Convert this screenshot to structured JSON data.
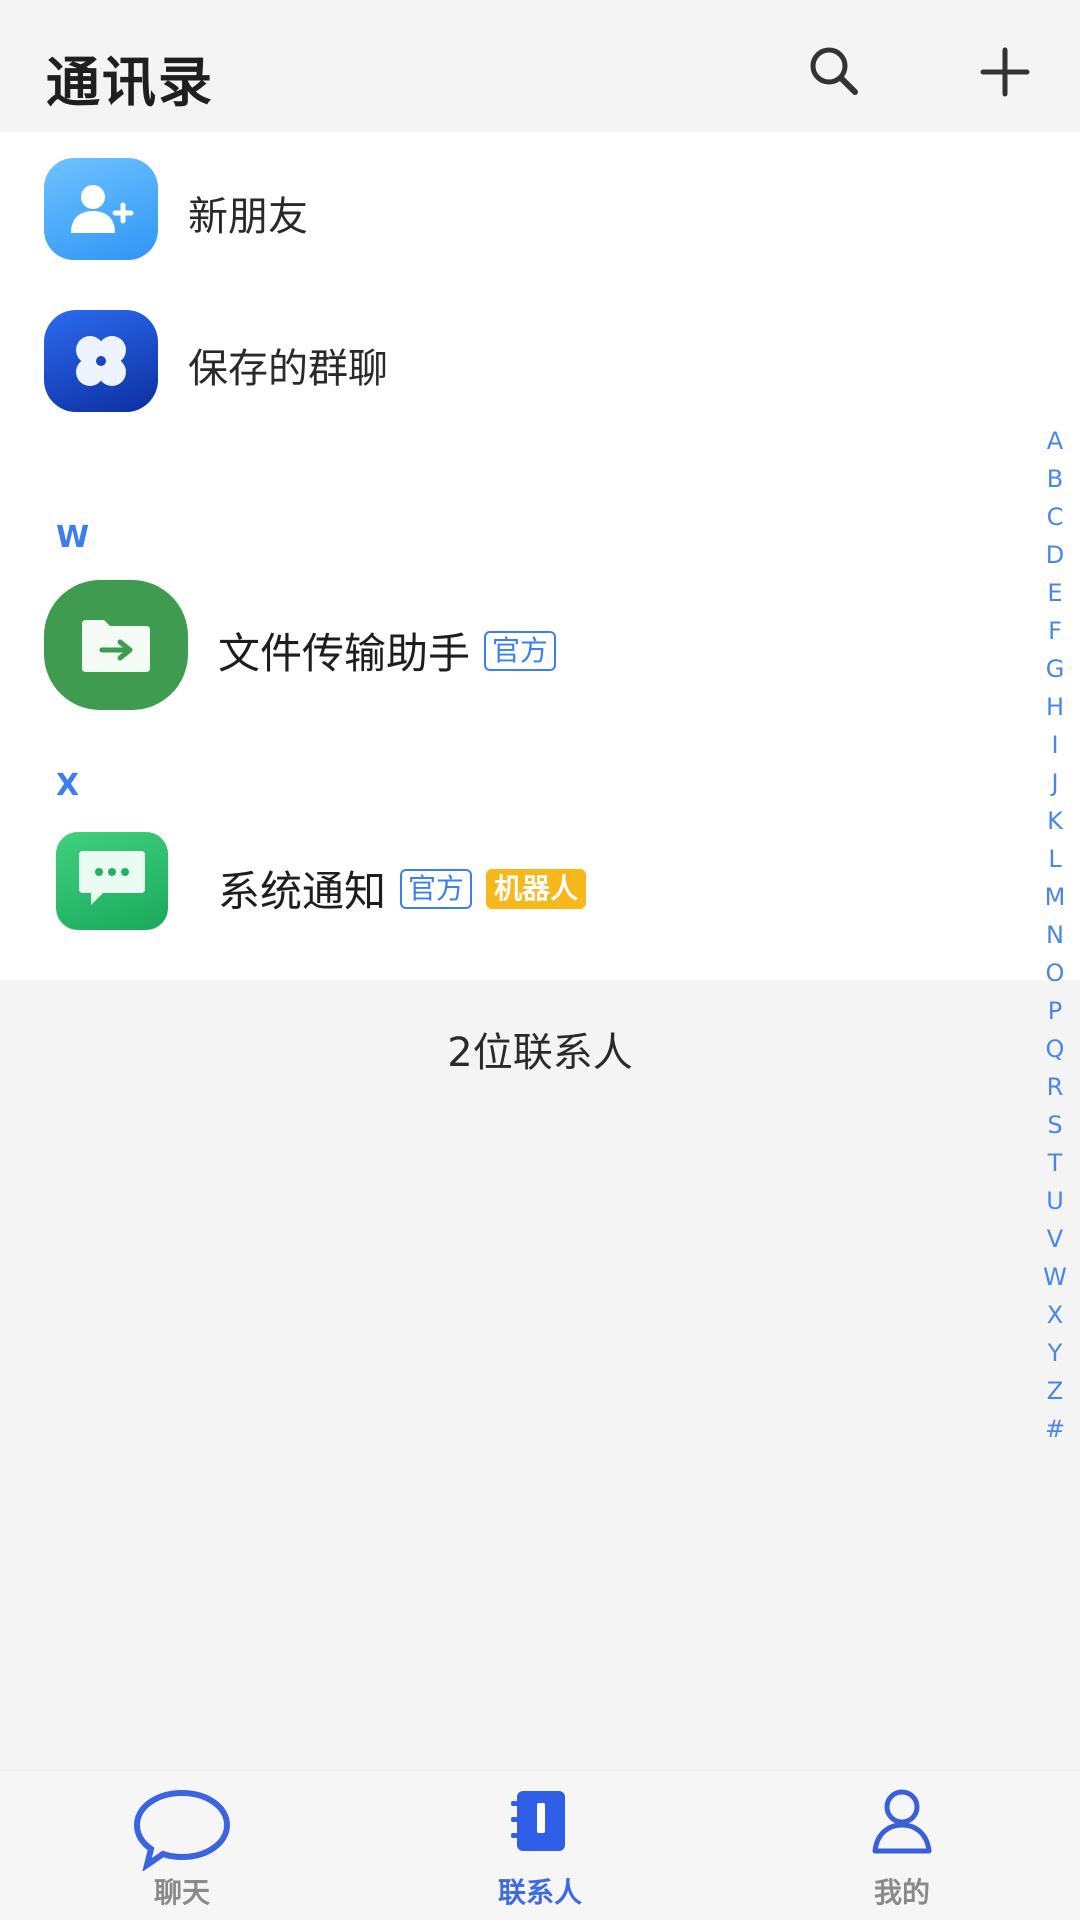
{
  "header": {
    "title": "通讯录"
  },
  "icons": {
    "search": "search-icon",
    "add": "plus-icon"
  },
  "list": {
    "new_friends": "新朋友",
    "saved_groups": "保存的群聊",
    "sections": [
      {
        "letter": "W",
        "contact": {
          "name": "文件传输助手",
          "tags": [
            "官方"
          ]
        }
      },
      {
        "letter": "X",
        "contact": {
          "name": "系统通知",
          "tags": [
            "官方",
            "机器人"
          ]
        }
      }
    ],
    "count_text": "2位联系人"
  },
  "alphabet": [
    "A",
    "B",
    "C",
    "D",
    "E",
    "F",
    "G",
    "H",
    "I",
    "J",
    "K",
    "L",
    "M",
    "N",
    "O",
    "P",
    "Q",
    "R",
    "S",
    "T",
    "U",
    "V",
    "W",
    "X",
    "Y",
    "Z",
    "#"
  ],
  "nav": {
    "chat": "聊天",
    "contacts": "联系人",
    "me": "我的",
    "active": "contacts"
  },
  "colors": {
    "accent": "#3b7ff3",
    "robot_tag": "#f6b81b",
    "file_helper": "#3e9b4f",
    "system_notice": "#22c06a",
    "groups": "#1549c8"
  }
}
